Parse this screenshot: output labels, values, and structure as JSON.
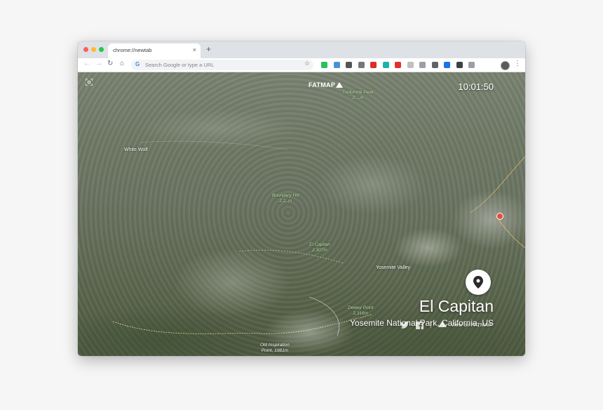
{
  "browser": {
    "tab_title": "chrome://newtab",
    "tab_close": "×",
    "new_tab": "+",
    "omnibox_placeholder": "Search Google or type a URL",
    "google_glyph": "G"
  },
  "colors": {
    "tab_bar": "#dee1e6",
    "close_dot": "#fe5f57",
    "minimize_dot": "#febc2e",
    "maximize_dot": "#28c840"
  },
  "extensions": [
    {
      "name": "evernote-icon",
      "color": "#2dbe60"
    },
    {
      "name": "ext-blue-icon",
      "color": "#4a90d9"
    },
    {
      "name": "pocket-icon",
      "color": "#555555"
    },
    {
      "name": "camera-icon",
      "color": "#777777"
    },
    {
      "name": "ext-red-icon",
      "color": "#d93025"
    },
    {
      "name": "ext-teal-icon",
      "color": "#20b2aa"
    },
    {
      "name": "adblock-icon",
      "color": "#e03030"
    },
    {
      "name": "ext-grey-icon",
      "color": "#c0c0c0"
    },
    {
      "name": "shield-icon",
      "color": "#9aa0a6"
    },
    {
      "name": "ext-dark-icon",
      "color": "#5f6368"
    },
    {
      "name": "ext-blue2-icon",
      "color": "#1a73e8"
    },
    {
      "name": "checkmark-icon",
      "color": "#3c4043"
    },
    {
      "name": "ext-a-icon",
      "color": "#9aa0a6"
    }
  ],
  "map": {
    "logo": "FATMAP",
    "clock": "10:01:50",
    "labels": {
      "tuolumne": [
        "Tuolumne Peak",
        "2,...m"
      ],
      "boundary": [
        "Boundary Hill",
        "2,2..m"
      ],
      "elcap": [
        "El Capitan",
        "2,307m"
      ],
      "dewey": [
        "Dewey Point",
        "2,316m"
      ],
      "inspiration": [
        "Old Inspiration",
        "Point, 1981m"
      ]
    },
    "places": {
      "white_wolf": "White Wolf",
      "yosemite_valley": "Yosemite Valley"
    },
    "title": "El Capitan",
    "subtitle": "Yosemite National Park, California, US",
    "divider": "|",
    "view_link": "View on FATMAP"
  }
}
